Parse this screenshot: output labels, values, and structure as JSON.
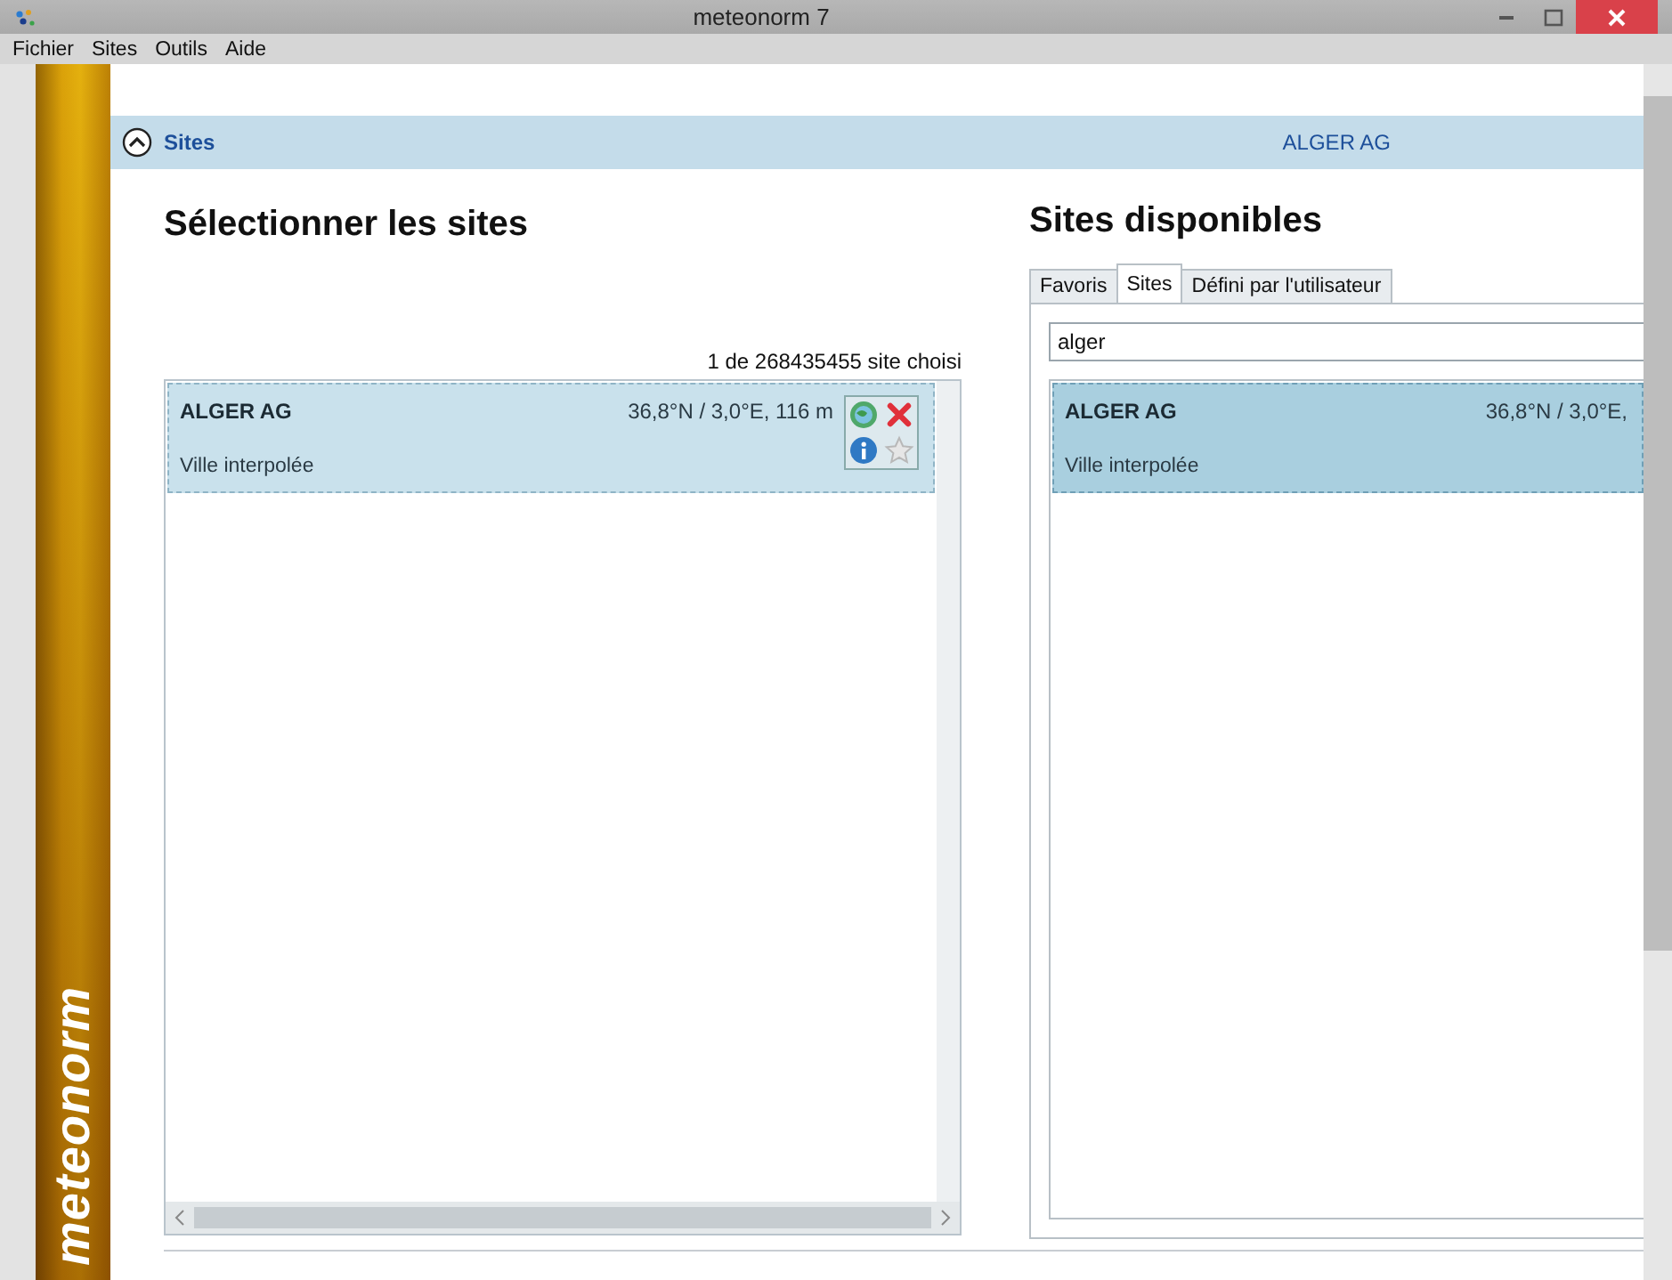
{
  "window": {
    "title": "meteonorm 7"
  },
  "menu": [
    "Fichier",
    "Sites",
    "Outils",
    "Aide"
  ],
  "sidebar": {
    "logo": "meteonorm"
  },
  "section": {
    "title": "Sites",
    "expanded": true,
    "current_site": "ALGER AG"
  },
  "selected_sites": {
    "heading": "Sélectionner les sites",
    "count": "1 de 268435455 site choisi",
    "items": [
      {
        "name": "ALGER AG",
        "coords": "36,8°N / 3,0°E, 116 m",
        "type": "Ville interpolée"
      }
    ]
  },
  "available_sites": {
    "heading": "Sites disponibles",
    "tabs": [
      {
        "label": "Favoris",
        "selected": false
      },
      {
        "label": "Sites",
        "selected": true
      },
      {
        "label": "Défini par l'utilisateur",
        "selected": false
      }
    ],
    "search": {
      "value": "alger"
    },
    "items": [
      {
        "name": "ALGER AG",
        "coords": "36,8°N / 3,0°E,",
        "type": "Ville interpolée",
        "selected": true
      }
    ]
  }
}
